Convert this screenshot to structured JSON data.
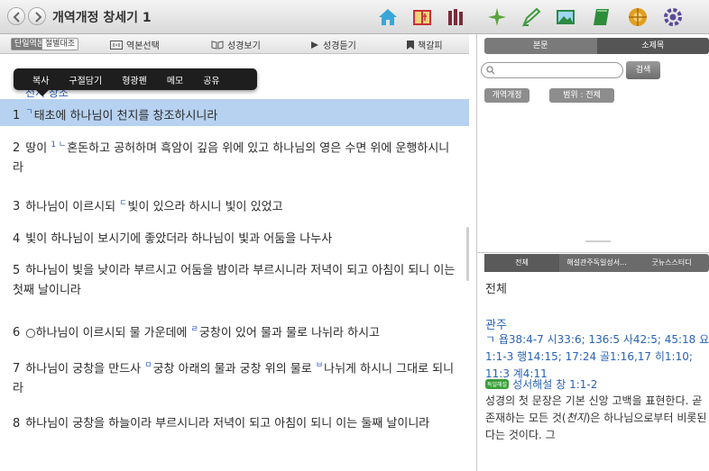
{
  "title": "개역개정 창세기 1",
  "toolbar": {
    "seg_single": "단일역본",
    "seg_compare": "절별대조",
    "select_version": "역본선택",
    "bible_view": "성경보기",
    "listen": "성경듣기",
    "bookmark": "책갈피"
  },
  "context_menu": [
    "복사",
    "구절담기",
    "형광펜",
    "메모",
    "공유"
  ],
  "chapter_header": "천지 창조",
  "verses": [
    {
      "num": "1",
      "parts": [
        {
          "fn": "ㄱ"
        },
        {
          "t": "태초에 하나님이 천지를 창조하시니라"
        }
      ]
    },
    {
      "num": "2",
      "parts": [
        {
          "t": "땅이 "
        },
        {
          "fn": "1 ㄴ"
        },
        {
          "t": "혼돈하고 공허하며 흑암이 깊음 위에 있고 하나님의 영은 수면 위에 운행하시니라"
        }
      ]
    },
    {
      "num": "3",
      "parts": [
        {
          "t": "하나님이 이르시되 "
        },
        {
          "fn": "ㄷ"
        },
        {
          "t": "빛이 있으라 하시니 빛이 있었고"
        }
      ]
    },
    {
      "num": "4",
      "parts": [
        {
          "t": "빛이 하나님이 보시기에 좋았더라 하나님이 빛과 어둠을 나누사"
        }
      ]
    },
    {
      "num": "5",
      "parts": [
        {
          "t": "하나님이 빛을 낮이라 부르시고 어둠을 밤이라 부르시니라 저녁이 되고 아침이 되니 이는 첫째 날이니라"
        }
      ]
    },
    {
      "num": "6",
      "parts": [
        {
          "t": "○하나님이 이르시되 물 가운데에 "
        },
        {
          "fn": "ㄹ"
        },
        {
          "t": "궁창이 있어 물과 물로 나뉘라 하시고"
        }
      ]
    },
    {
      "num": "7",
      "parts": [
        {
          "t": "하나님이 궁창을 만드사 "
        },
        {
          "fn": "ㅁ"
        },
        {
          "t": "궁창 아래의 물과 궁창 위의 물로 "
        },
        {
          "fn": "ㅂ"
        },
        {
          "t": "나뉘게 하시니 그대로 되니라"
        }
      ]
    },
    {
      "num": "8",
      "parts": [
        {
          "t": "하나님이 궁창을 하늘이라 부르시니라 저녁이 되고 아침이 되니 이는 둘째 날이니라"
        }
      ]
    }
  ],
  "right": {
    "tab_body": "본문",
    "tab_subtitle": "소제목",
    "search_placeholder": "",
    "search_button": "검색",
    "filter_version": "개역개정",
    "filter_range": "범위 : 전체",
    "tabs2": [
      "전체",
      "해설관주독일성서...",
      "굿뉴스스터디"
    ],
    "section_all": "전체",
    "section_refs_title": "관주",
    "refs_text": "ㄱ 욥38:4-7 시33:6; 136:5 사42:5; 45:18 요1:1-3 행14:15; 17:24 골1:16,17 히1:10; 11:3 계4:11",
    "commentary_badge": "독일해설",
    "commentary_title": "성서해설",
    "commentary_ref": "창 1:1-2",
    "commentary_text_1": "성경의 첫 문장은 기본 신앙 고백을 표현한다. 곧 존재하는 모든 것(",
    "commentary_em": "천지",
    "commentary_text_2": ")은 하나님으로부터 비롯된다는 것이다. 그"
  },
  "colors": {
    "selection": "#b7d2f0",
    "link": "#2a63b6"
  }
}
